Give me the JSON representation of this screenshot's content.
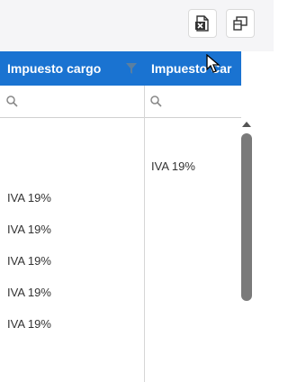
{
  "toolbar": {
    "export_excel_icon": "excel-export-icon",
    "column_chooser_icon": "column-chooser-icon"
  },
  "grid": {
    "columns": [
      {
        "label": "Impuesto cargo",
        "has_filter_icon": true
      },
      {
        "label": "Impuesto Car"
      }
    ],
    "col1_cells": [
      "IVA 19%",
      "IVA 19%",
      "IVA 19%",
      "IVA 19%",
      "IVA 19%"
    ],
    "col2_cells": [
      "IVA 19%"
    ]
  },
  "colors": {
    "header_bg": "#1a73d1",
    "header_text": "#ffffff",
    "filter_icon": "#5a7fa0"
  }
}
